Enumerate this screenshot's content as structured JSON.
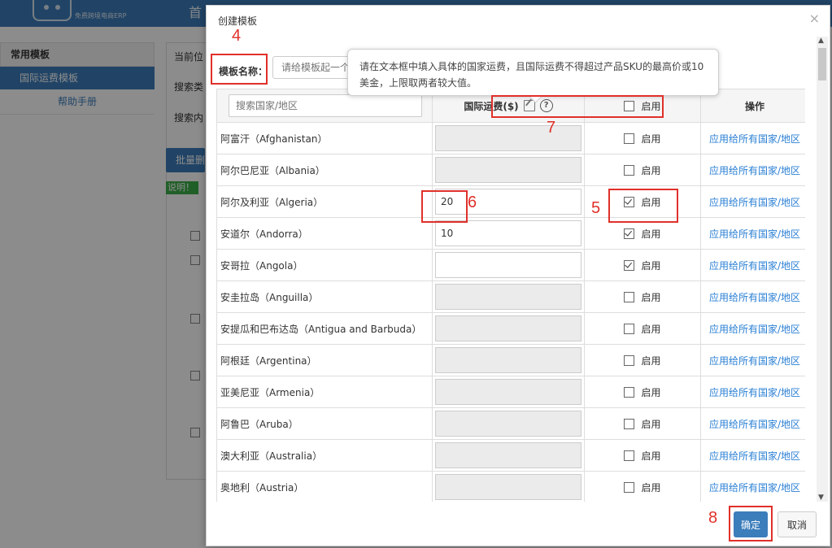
{
  "background": {
    "logo_sub": "免费跨境电商ERP",
    "nav_home": "首",
    "sidebar": {
      "header": "常用模板",
      "active_item": "国际运费模板",
      "help": "帮助手册"
    },
    "fragments": {
      "current": "当前位",
      "search_type": "搜索类",
      "search_content": "搜索内",
      "batch": "批量删",
      "note": "说明！"
    }
  },
  "modal": {
    "title": "创建模板",
    "close": "×",
    "name_label": "模板名称：",
    "name_placeholder": "请给模板起一个",
    "tooltip": "请在文本框中填入具体的国家运费，且国际运费不得超过产品SKU的最高价或10美金，上限取两者较大值。",
    "table": {
      "search_placeholder": "搜索国家/地区",
      "fee_header": "国际运费($)",
      "help_glyph": "?",
      "enable_header": "启用",
      "action_header": "操作",
      "enable_label": "启用",
      "apply_label": "应用给所有国家/地区",
      "rows": [
        {
          "country": "阿富汗（Afghanistan）",
          "fee": "",
          "checked": false
        },
        {
          "country": "阿尔巴尼亚（Albania）",
          "fee": "",
          "checked": false
        },
        {
          "country": "阿尔及利亚（Algeria）",
          "fee": "20",
          "checked": true
        },
        {
          "country": "安道尔（Andorra）",
          "fee": "10",
          "checked": true
        },
        {
          "country": "安哥拉（Angola）",
          "fee": "",
          "checked": true
        },
        {
          "country": "安圭拉岛（Anguilla）",
          "fee": "",
          "checked": false
        },
        {
          "country": "安提瓜和巴布达岛（Antigua and Barbuda）",
          "fee": "",
          "checked": false
        },
        {
          "country": "阿根廷（Argentina）",
          "fee": "",
          "checked": false
        },
        {
          "country": "亚美尼亚（Armenia）",
          "fee": "",
          "checked": false
        },
        {
          "country": "阿鲁巴（Aruba）",
          "fee": "",
          "checked": false
        },
        {
          "country": "澳大利亚（Australia）",
          "fee": "",
          "checked": false
        },
        {
          "country": "奥地利（Austria）",
          "fee": "",
          "checked": false
        }
      ]
    },
    "confirm": "确定",
    "cancel": "取消"
  },
  "annotations": [
    "4",
    "5",
    "6",
    "7",
    "8"
  ],
  "colors": {
    "accent": "#3c7dbb",
    "annotation": "#e0302a",
    "link": "#2a7fd4"
  }
}
